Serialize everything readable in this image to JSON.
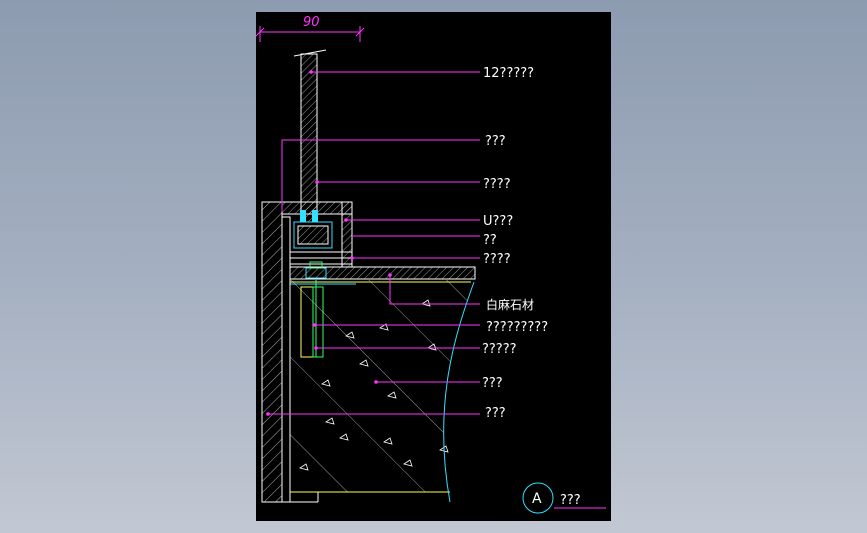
{
  "dimension": {
    "value": "90"
  },
  "labels": [
    {
      "id": "label-glass",
      "text": "12?????"
    },
    {
      "id": "label-2",
      "text": "???"
    },
    {
      "id": "label-3",
      "text": "????"
    },
    {
      "id": "label-u-channel",
      "text": "U???"
    },
    {
      "id": "label-5",
      "text": "??"
    },
    {
      "id": "label-6",
      "text": "????"
    },
    {
      "id": "label-stone",
      "text": "白麻石材"
    },
    {
      "id": "label-8",
      "text": "?????????"
    },
    {
      "id": "label-9",
      "text": "?????"
    },
    {
      "id": "label-10",
      "text": "???"
    },
    {
      "id": "label-11",
      "text": "???"
    }
  ],
  "detail_tag": {
    "letter": "A",
    "title": "???"
  },
  "colors": {
    "background": "#000000",
    "leader": "#ff33ff",
    "outline": "#ffffff",
    "curve": "#33e0ff",
    "stone_line": "#ffff55",
    "anchor": "#33ff66"
  }
}
